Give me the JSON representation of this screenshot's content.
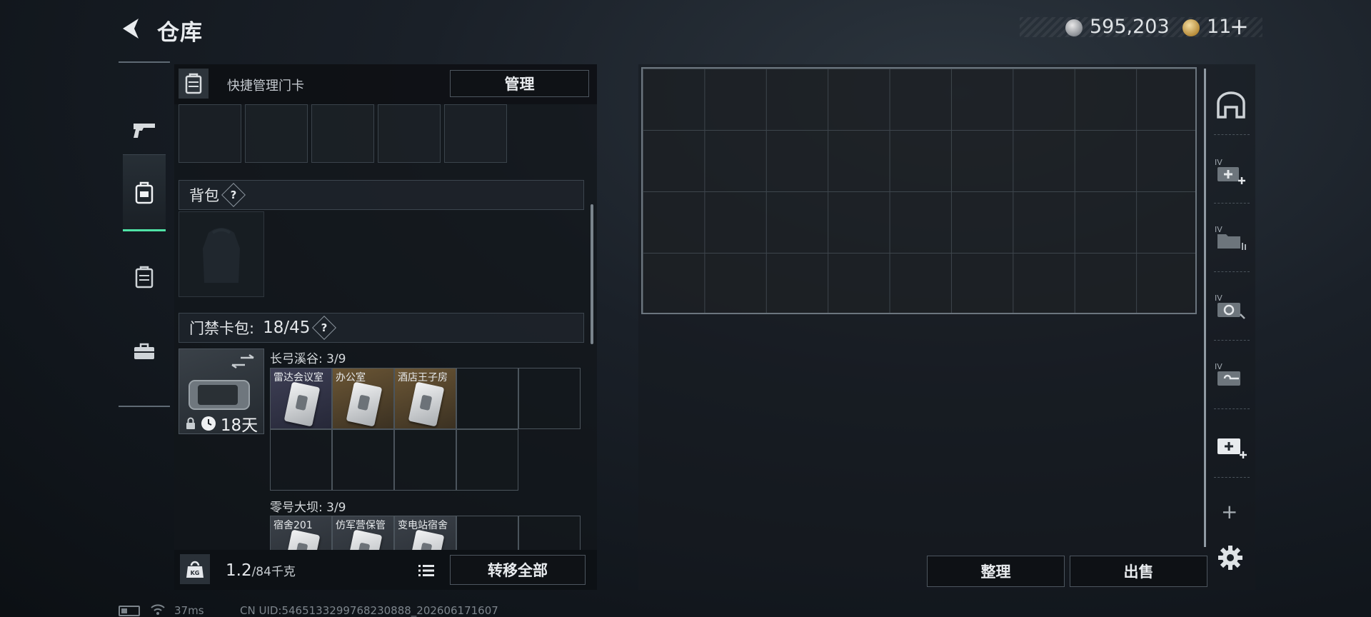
{
  "header": {
    "title": "仓库",
    "currency_silver": "595,203",
    "currency_gold": "11",
    "add_symbol": "+"
  },
  "nav": {
    "items": [
      {
        "name": "weapons",
        "icon": "pistol-icon"
      },
      {
        "name": "equipment",
        "icon": "backpack-icon",
        "active": true
      },
      {
        "name": "case",
        "icon": "keycase-icon"
      },
      {
        "name": "tools",
        "icon": "toolbox-icon"
      }
    ]
  },
  "left_panel": {
    "header_label": "快捷管理门卡",
    "manage_button": "管理",
    "backpack_label": "背包",
    "help": "?",
    "keycase_label": "门禁卡包:",
    "keycase_count": "18/45",
    "keycase_days": "18天",
    "maps": [
      {
        "label": "长弓溪谷: 3/9",
        "keys": [
          "雷达会议室",
          "办公室",
          "酒店王子房"
        ]
      },
      {
        "label": "零号大坝: 3/9",
        "keys": [
          "宿舍201",
          "仿军营保管",
          "变电站宿舍"
        ]
      }
    ],
    "weight_value": "1.2",
    "weight_capacity": "/84千克",
    "transfer_button": "转移全部"
  },
  "storage": {
    "columns": 9,
    "rows": 4,
    "sort_button": "整理",
    "sell_button": "出售",
    "side_tabs": [
      "warehouse-arch-icon",
      "medical-case-add-icon",
      "folder-archive-icon",
      "ammo-case-icon",
      "key-case-icon",
      "new-case-add-icon"
    ],
    "tab_tier": "IV",
    "add_tab": "+"
  },
  "status_bar": {
    "ping": "37ms",
    "uid": "CN UID:5465133299768230888_202606171607"
  },
  "colors": {
    "accent": "#4fe3a6",
    "background": "#141a20",
    "panel": "#12161b"
  }
}
